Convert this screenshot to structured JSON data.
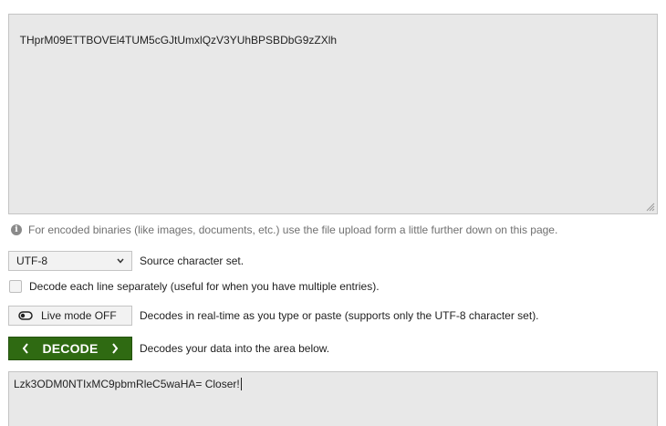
{
  "input": {
    "value": "THprM09ETTBOVEl4TUM5cGJtUmxlQzV3YUhBPSBDbG9zZXlh"
  },
  "note": {
    "icon": "info-icon",
    "text": "For encoded binaries (like images, documents, etc.) use the file upload form a little further down on this page."
  },
  "charset": {
    "selected": "UTF-8",
    "description": "Source character set."
  },
  "separate_lines": {
    "checked": false,
    "label": "Decode each line separately (useful for when you have multiple entries)."
  },
  "live_mode": {
    "label": "Live mode OFF",
    "description": "Decodes in real-time as you type or paste (supports only the UTF-8 character set)."
  },
  "decode": {
    "label": "DECODE",
    "description": "Decodes your data into the area below.",
    "color": "#2f6a12"
  },
  "output": {
    "value": "Lzk3ODM0NTIxMC9pbmRleC5waHA= Closer!"
  }
}
